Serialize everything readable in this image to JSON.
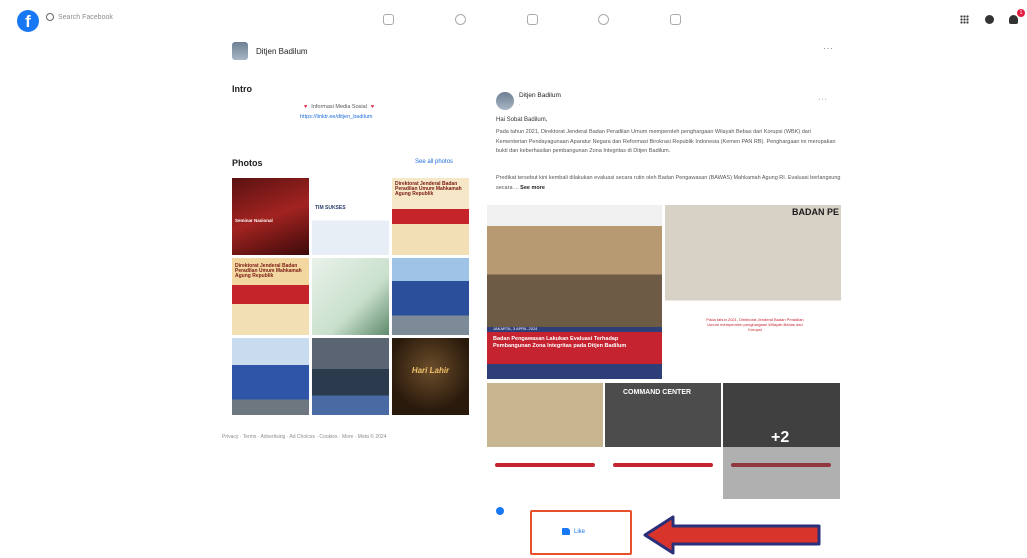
{
  "topbar": {
    "logo": "f",
    "search_placeholder": "Search Facebook",
    "notification_count": "1"
  },
  "profile": {
    "name": "Ditjen Badilum",
    "more": "···"
  },
  "intro": {
    "title": "Intro",
    "text": "Informasi Media Sosial",
    "link": "https://linktr.ee/ditjen_badilum"
  },
  "photos": {
    "title": "Photos",
    "see_all": "See all photos",
    "tiles": [
      {
        "label": "Seminar Nasional"
      },
      {
        "label": "TIM SUKSES"
      },
      {
        "label": "Direktorat Jenderal Badan Peradilan Umum Mahkamah Agung Republik"
      },
      {
        "label": "Direktorat Jenderal Badan Peradilan Umum Mahkamah Agung Republik"
      },
      {
        "label": ""
      },
      {
        "label": ""
      },
      {
        "label": ""
      },
      {
        "label": ""
      },
      {
        "label": "Hari Lahir"
      }
    ]
  },
  "footer": "Privacy · Terms · Advertising · Ad Choices · Cookies · More · Meta © 2024",
  "post": {
    "author": "Ditjen Badilum",
    "meta": "·",
    "more": "···",
    "greeting": "Hai Sobat Badilum,",
    "paragraph1": "Pada tahun 2021, Direktorat Jenderal Badan Peradilan Umum memperoleh penghargaan Wilayah Bebas dari Korupsi (WBK) dari Kementerian Pendayagunaan Aparatur Negara dan Reformasi Birokrasi Republik Indonesia (Kemen PAN RB). Penghargaan ini merupakan bukti dan keberhasilan pembangunan Zona Integritas di Ditjen Badilum.",
    "paragraph2": "Predikat tersebut kini kembali dilakukan evaluasi secara rutin oleh Badan Pengawasan (BAWAS) Mahkamah Agung RI. Evaluasi berlangsung secara ...",
    "see_more": "See more",
    "main_image": {
      "date": "JAKARTA, 3 APRIL 2024",
      "caption": "Badan Pengawasan Lakukan Evaluasi Terhadap Pembangunan Zona Integritas pada Ditjen Badilum"
    },
    "top_right_image": {
      "banner": "BADAN PE",
      "caption": "Pada tahun 2021, Direktorat Jenderal Badan Peradilan Umum memperoleh penghargaan Wilayah Bebas dari Korupsi"
    },
    "bottom_middle_image": {
      "banner": "COMMAND CENTER"
    },
    "more_images": "+2",
    "reactions": "",
    "like_label": "Like"
  }
}
